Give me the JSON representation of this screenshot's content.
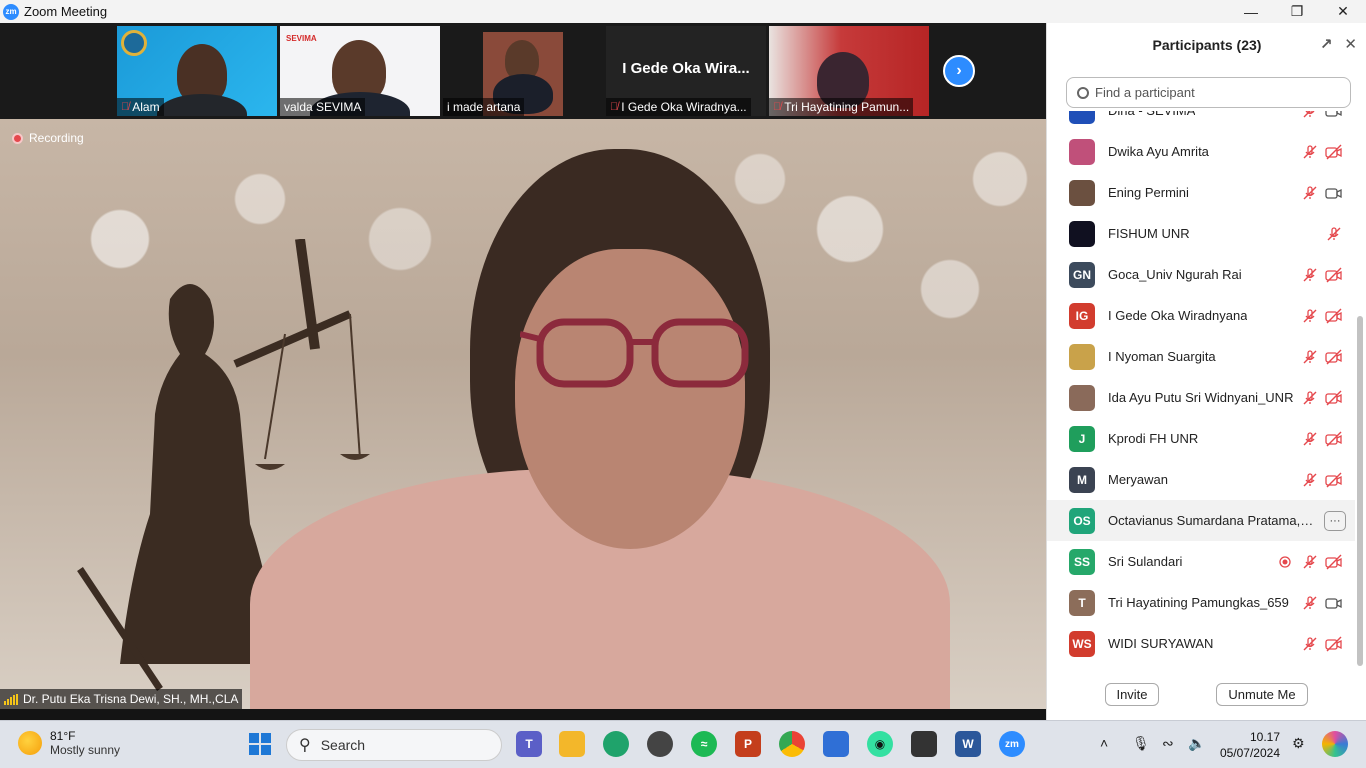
{
  "window": {
    "title": "Zoom Meeting",
    "app_icon": "zm"
  },
  "thumbnails": [
    {
      "name": "Alam",
      "muted": true
    },
    {
      "name": "valda SEVIMA",
      "muted": false,
      "logo_text": "SEVIMA"
    },
    {
      "name": "i made artana",
      "muted": false
    },
    {
      "name": "I Gede Oka Wiradnya...",
      "muted": true,
      "big_label": "I Gede Oka Wira..."
    },
    {
      "name": "Tri Hayatining Pamun...",
      "muted": true
    }
  ],
  "main_video": {
    "recording_label": "Recording",
    "speaker_name": "Dr. Putu Eka Trisna Dewi, SH., MH.,CLA"
  },
  "participants_panel": {
    "title": "Participants (23)",
    "search_placeholder": "Find a participant",
    "participants": [
      {
        "name": "Dina - SEVIMA",
        "avatar_text": "",
        "avatar_color": "#1f4fb8",
        "mic_muted": true,
        "video_off": false
      },
      {
        "name": "Dwika Ayu Amrita",
        "avatar_text": "",
        "avatar_color": "#c0507a",
        "mic_muted": true,
        "video_off": true
      },
      {
        "name": "Ening Permini",
        "avatar_text": "",
        "avatar_color": "#6b5040",
        "mic_muted": true,
        "video_off": false
      },
      {
        "name": "FISHUM UNR",
        "avatar_text": "",
        "avatar_color": "#101020",
        "mic_muted": true,
        "video_off": null
      },
      {
        "name": "Goca_Univ Ngurah Rai",
        "avatar_text": "GN",
        "avatar_color": "#3c4a5c",
        "mic_muted": true,
        "video_off": true
      },
      {
        "name": "I Gede Oka Wiradnyana",
        "avatar_text": "IG",
        "avatar_color": "#d23c2e",
        "mic_muted": true,
        "video_off": true
      },
      {
        "name": "I Nyoman Suargita",
        "avatar_text": "",
        "avatar_color": "#c9a24a",
        "mic_muted": true,
        "video_off": true
      },
      {
        "name": "Ida Ayu Putu Sri Widnyani_UNR",
        "avatar_text": "",
        "avatar_color": "#8a6a5a",
        "mic_muted": true,
        "video_off": true
      },
      {
        "name": "Kprodi FH UNR",
        "avatar_text": "J",
        "avatar_color": "#1f9e5c",
        "mic_muted": true,
        "video_off": true
      },
      {
        "name": "Meryawan",
        "avatar_text": "M",
        "avatar_color": "#3b4352",
        "mic_muted": true,
        "video_off": true
      },
      {
        "name": "Octavianus Sumardana Pratama,S....",
        "avatar_text": "OS",
        "avatar_color": "#20a57a",
        "mic_muted": null,
        "video_off": null,
        "more_label": "···"
      },
      {
        "name": "Sri Sulandari",
        "avatar_text": "SS",
        "avatar_color": "#26a86a",
        "mic_muted": true,
        "video_off": true,
        "recording": true
      },
      {
        "name": "Tri Hayatining Pamungkas_659",
        "avatar_text": "T",
        "avatar_color": "#8c6d5a",
        "mic_muted": true,
        "video_off": false
      },
      {
        "name": "WIDI SURYAWAN",
        "avatar_text": "WS",
        "avatar_color": "#d23c2e",
        "mic_muted": true,
        "video_off": true
      }
    ],
    "invite_label": "Invite",
    "unmute_label": "Unmute Me"
  },
  "taskbar": {
    "weather_temp": "81°F",
    "weather_desc": "Mostly sunny",
    "search_label": "Search",
    "time": "10.17",
    "date": "05/07/2024",
    "pinned_apps": [
      "windows-start",
      "teams",
      "file-explorer",
      "edge",
      "security-app",
      "spotify",
      "powerpoint",
      "chrome",
      "calendar",
      "tripadvisor",
      "capture-app",
      "word",
      "zoom"
    ]
  },
  "colors": {
    "accent": "#2d8cff",
    "muted_red": "#e5484d",
    "panel_bg": "#ffffff"
  }
}
